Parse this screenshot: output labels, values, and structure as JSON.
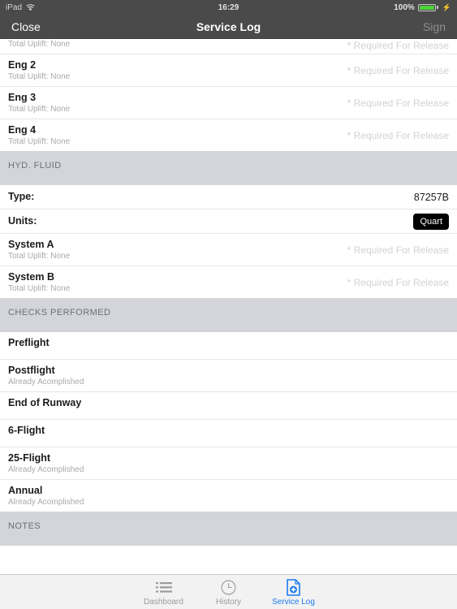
{
  "status_bar": {
    "device": "iPad",
    "wifi_icon": "wifi-icon",
    "time": "16:29",
    "battery_percent": "100%",
    "battery_icon": "battery-full-icon",
    "charging_icon": "lightning-bolt-icon"
  },
  "nav": {
    "close_label": "Close",
    "title": "Service Log",
    "sign_label": "Sign",
    "sign_enabled": false,
    "background": "#4a4a4a"
  },
  "sections": [
    {
      "id": "engines",
      "header": "",
      "rows": [
        {
          "title": "",
          "subtitle": "Total Uplift: None",
          "required": "* Required For Release",
          "clipped": true
        },
        {
          "title": "Eng 2",
          "subtitle": "Total Uplift: None",
          "required": "* Required For Release"
        },
        {
          "title": "Eng 3",
          "subtitle": "Total Uplift: None",
          "required": "* Required For Release"
        },
        {
          "title": "Eng 4",
          "subtitle": "Total Uplift: None",
          "required": "* Required For Release"
        }
      ]
    },
    {
      "id": "hyd-fluid",
      "header": "HYD. FLUID",
      "rows": [
        {
          "title": "Type:",
          "value": "87257B",
          "kind": "kv"
        },
        {
          "title": "Units:",
          "button": "Quart",
          "kind": "kv"
        },
        {
          "title": "System A",
          "subtitle": "Total Uplift: None",
          "required": "* Required For Release"
        },
        {
          "title": "System B",
          "subtitle": "Total Uplift: None",
          "required": "* Required For Release"
        }
      ]
    },
    {
      "id": "checks-performed",
      "header": "CHECKS PERFORMED",
      "rows": [
        {
          "title": "Preflight",
          "subtitle": ""
        },
        {
          "title": "Postflight",
          "subtitle": "Already Acomplished"
        },
        {
          "title": "End of Runway",
          "subtitle": ""
        },
        {
          "title": "6-Flight",
          "subtitle": ""
        },
        {
          "title": "25-Flight",
          "subtitle": "Already Acomplished"
        },
        {
          "title": "Annual",
          "subtitle": "Already Acomplished"
        }
      ]
    },
    {
      "id": "notes",
      "header": "NOTES",
      "rows": []
    }
  ],
  "tabbar": {
    "active_color": "#1b7aef",
    "inactive_color": "#9b9b9b",
    "tabs": [
      {
        "label": "Dashboard",
        "icon": "list-icon",
        "active": false
      },
      {
        "label": "History",
        "icon": "clock-icon",
        "active": false
      },
      {
        "label": "Service Log",
        "icon": "document-plus-icon",
        "active": true
      }
    ]
  }
}
